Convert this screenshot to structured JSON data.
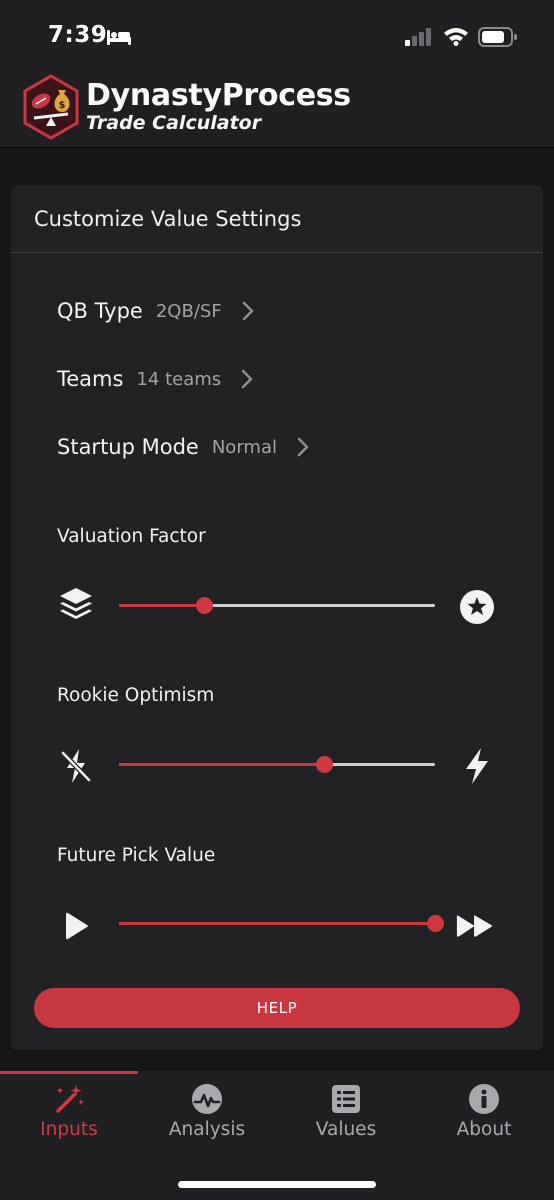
{
  "status_bar": {
    "time": "7:39"
  },
  "app_header": {
    "title": "DynastyProcess",
    "subtitle": "Trade Calculator"
  },
  "card": {
    "title": "Customize Value Settings",
    "settings": [
      {
        "label": "QB Type",
        "value": "2QB/SF"
      },
      {
        "label": "Teams",
        "value": "14 teams"
      },
      {
        "label": "Startup Mode",
        "value": "Normal"
      }
    ],
    "sliders": [
      {
        "label": "Valuation Factor",
        "left_icon": "layers-icon",
        "right_icon": "star-circle-icon",
        "value": 0.27
      },
      {
        "label": "Rookie Optimism",
        "left_icon": "bolt-slash-icon",
        "right_icon": "bolt-icon",
        "value": 0.65
      },
      {
        "label": "Future Pick Value",
        "left_icon": "play-icon",
        "right_icon": "fast-forward-icon",
        "value": 1.0
      }
    ],
    "help_label": "HELP"
  },
  "nav": {
    "items": [
      {
        "label": "Inputs",
        "icon": "magic-wand-icon",
        "active": true
      },
      {
        "label": "Analysis",
        "icon": "chart-gauge-icon",
        "active": false
      },
      {
        "label": "Values",
        "icon": "list-icon",
        "active": false
      },
      {
        "label": "About",
        "icon": "info-icon",
        "active": false
      }
    ]
  },
  "colors": {
    "accent": "#c93741",
    "background": "#161616",
    "card": "#222224",
    "muted_text": "#a3a3a6"
  }
}
